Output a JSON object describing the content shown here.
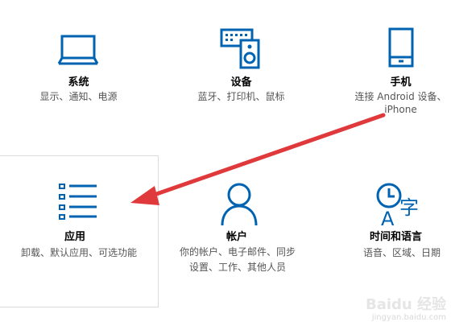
{
  "tiles": [
    {
      "id": "system",
      "title": "系统",
      "desc": [
        "显示、通知、电源"
      ],
      "icon": "laptop-icon"
    },
    {
      "id": "devices",
      "title": "设备",
      "desc": [
        "蓝牙、打印机、鼠标"
      ],
      "icon": "devices-icon"
    },
    {
      "id": "phone",
      "title": "手机",
      "desc": [
        "连接 Android 设备、",
        "iPhone"
      ],
      "icon": "phone-icon"
    },
    {
      "id": "apps",
      "title": "应用",
      "desc": [
        "卸载、默认应用、可选功能"
      ],
      "icon": "apps-list-icon"
    },
    {
      "id": "accounts",
      "title": "帐户",
      "desc": [
        "你的帐户、电子邮件、同步",
        "设置、工作、其他人员"
      ],
      "icon": "person-icon"
    },
    {
      "id": "time",
      "title": "时间和语言",
      "desc": [
        "语音、区域、日期"
      ],
      "icon": "time-language-icon"
    }
  ],
  "accent_color": "#0063b1",
  "arrow_color": "#e0393b",
  "watermark": {
    "brand": "Baidu 经验",
    "url": "jingyan.baidu.com"
  }
}
